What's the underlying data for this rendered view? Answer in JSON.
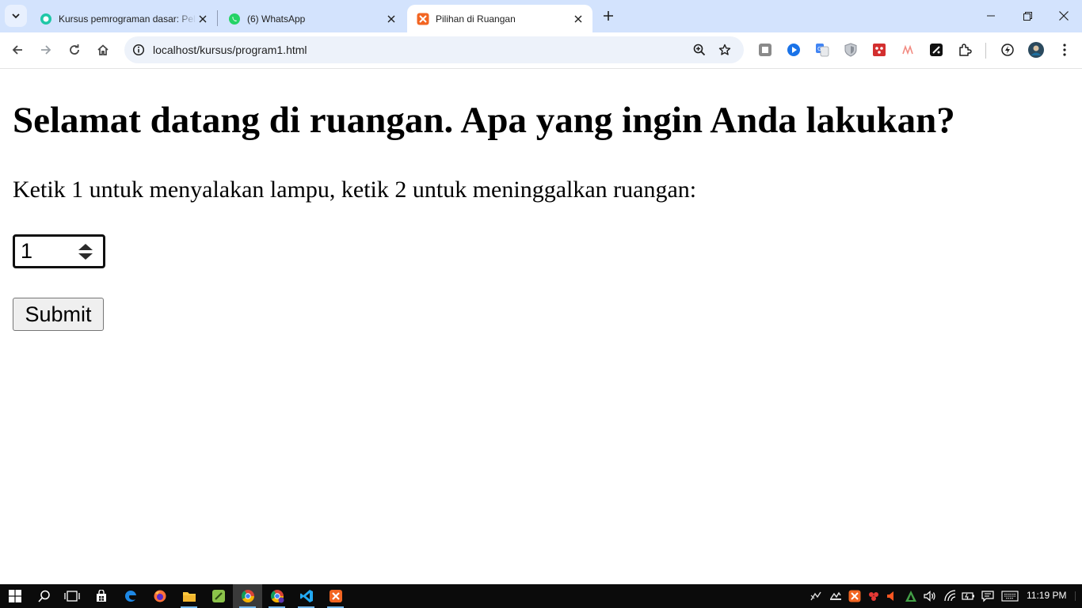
{
  "browser": {
    "tabs": [
      {
        "title": "Kursus pemrograman dasar: Pel",
        "icon": "course-app-icon",
        "active": false
      },
      {
        "title": "(6) WhatsApp",
        "icon": "whatsapp-icon",
        "active": false
      },
      {
        "title": "Pilihan di Ruangan",
        "icon": "xampp-icon",
        "active": true
      }
    ],
    "url": "localhost/kursus/program1.html",
    "colors": {
      "tabstrip": "#d3e3fd",
      "omnibox": "#edf2fa",
      "accent": "#0b57d0"
    }
  },
  "page": {
    "heading": "Selamat datang di ruangan. Apa yang ingin Anda lakukan?",
    "prompt": "Ketik 1 untuk menyalakan lampu, ketik 2 untuk meninggalkan ruangan:",
    "input_value": "1",
    "submit_label": "Submit"
  },
  "taskbar": {
    "apps": [
      "windows-start-icon",
      "search-icon",
      "task-view-icon",
      "store-icon",
      "edge-icon",
      "firefox-icon",
      "file-explorer-icon",
      "notepad-plus-icon",
      "chrome-icon",
      "chrome-profile-icon",
      "vscode-icon",
      "xampp-icon"
    ],
    "clock": "11:19 PM"
  }
}
